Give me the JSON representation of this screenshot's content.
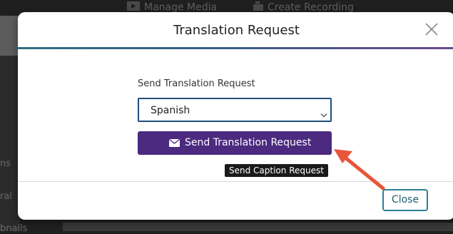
{
  "background": {
    "nav": {
      "manage_media": "Manage Media",
      "create_recording": "Create Recording"
    },
    "sidebar": {
      "labels": [
        "ns",
        "ral",
        "bnails"
      ]
    }
  },
  "modal": {
    "title": "Translation Request",
    "field_label": "Send Translation Request",
    "language_select": {
      "value": "Spanish"
    },
    "send_button_label": "Send Translation Request",
    "tooltip": "Send Caption Request",
    "close_button_label": "Close"
  },
  "icons": {
    "close": "close-x-icon",
    "dropdown": "chevron-down-icon",
    "send": "envelope-icon",
    "annotation": "red-arrow-annotation"
  },
  "colors": {
    "primary_button": "#4b2a7f",
    "select_border": "#1f4e79",
    "close_button_border": "#2d7f95",
    "annotation_arrow": "#e8553a"
  }
}
